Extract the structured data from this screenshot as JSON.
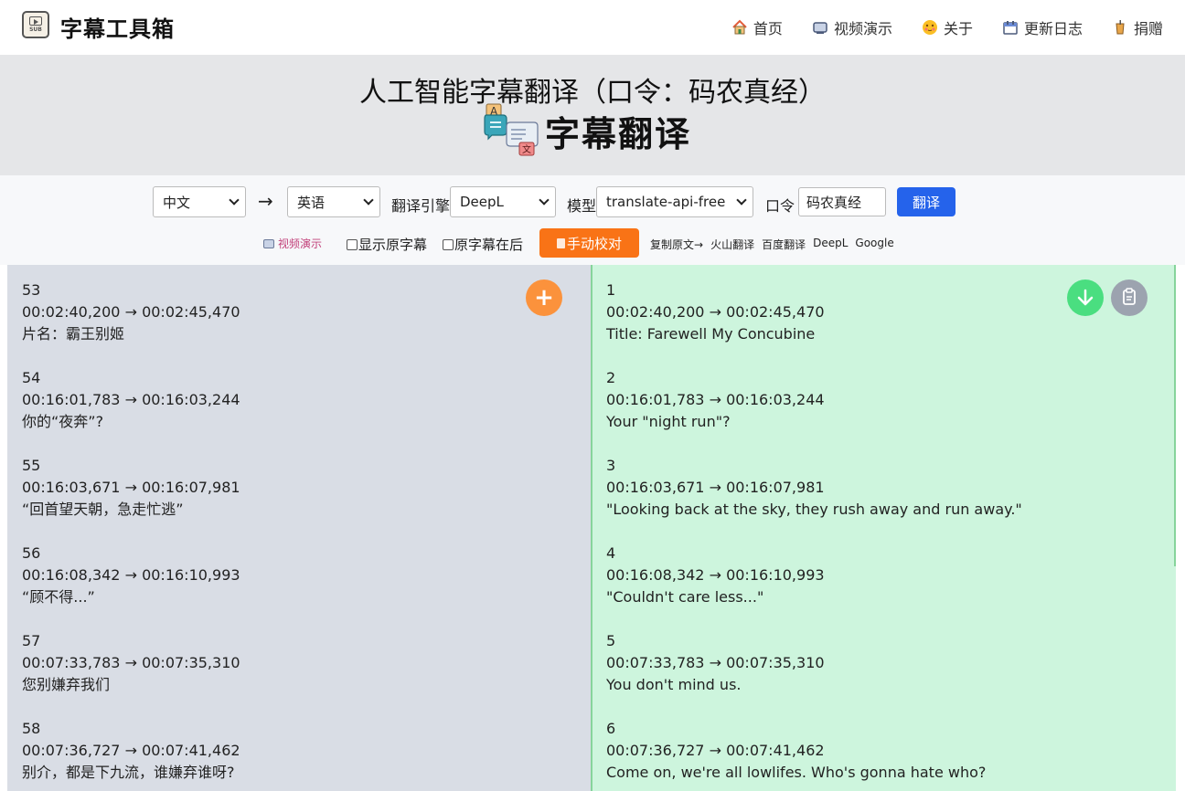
{
  "nav": {
    "brand": "字幕工具箱",
    "logo_text": "SUB",
    "items": [
      {
        "label": "首页",
        "icon": "house-icon"
      },
      {
        "label": "视频演示",
        "icon": "tv-icon"
      },
      {
        "label": "关于",
        "icon": "smiley-icon"
      },
      {
        "label": "更新日志",
        "icon": "calendar-icon"
      },
      {
        "label": "捐赠",
        "icon": "drink-icon"
      }
    ]
  },
  "hero": {
    "title": "人工智能字幕翻译（口令：码农真经）",
    "subtitle": "字幕翻译"
  },
  "controls": {
    "source_lang": "中文",
    "arrow": "→",
    "target_lang": "英语",
    "engine_label": "翻译引擎",
    "engine": "DeepL",
    "model_label": "模型",
    "model": "translate-api-free",
    "password_label": "口令",
    "password": "码农真经",
    "translate_btn": "翻译"
  },
  "options": {
    "demo_link": "视频演示",
    "show_original": "显示原字幕",
    "original_after": "原字幕在后",
    "manual_btn": "手动校对",
    "links": [
      "复制原文→",
      "火山翻译",
      "百度翻译",
      "DeepL",
      "Google"
    ]
  },
  "source_subtitles": [
    {
      "index": "53",
      "time": "00:02:40,200 → 00:02:45,470",
      "text": "片名：霸王别姬"
    },
    {
      "index": "54",
      "time": "00:16:01,783 → 00:16:03,244",
      "text": "你的“夜奔”?"
    },
    {
      "index": "55",
      "time": "00:16:03,671 → 00:16:07,981",
      "text": "“回首望天朝，急走忙逃”"
    },
    {
      "index": "56",
      "time": "00:16:08,342 → 00:16:10,993",
      "text": "“顾不得...”"
    },
    {
      "index": "57",
      "time": "00:07:33,783 → 00:07:35,310",
      "text": "您别嫌弃我们"
    },
    {
      "index": "58",
      "time": "00:07:36,727 → 00:07:41,462",
      "text": "别介，都是下九流，谁嫌弃谁呀?"
    }
  ],
  "translated_subtitles": [
    {
      "index": "1",
      "time": "00:02:40,200 → 00:02:45,470",
      "text": "Title: Farewell My Concubine"
    },
    {
      "index": "2",
      "time": "00:16:01,783 → 00:16:03,244",
      "text": "Your \"night run\"?"
    },
    {
      "index": "3",
      "time": "00:16:03,671 → 00:16:07,981",
      "text": "\"Looking back at the sky, they rush away and run away.\""
    },
    {
      "index": "4",
      "time": "00:16:08,342 → 00:16:10,993",
      "text": "\"Couldn't care less...\""
    },
    {
      "index": "5",
      "time": "00:07:33,783 → 00:07:35,310",
      "text": "You don't mind us."
    },
    {
      "index": "6",
      "time": "00:07:36,727 → 00:07:41,462",
      "text": "Come on, we're all lowlifes. Who's gonna hate who?"
    }
  ],
  "colors": {
    "primary": "#2563eb",
    "accent": "#f97316",
    "left_panel": "#d9dde5",
    "right_panel": "#cdf5dd"
  }
}
